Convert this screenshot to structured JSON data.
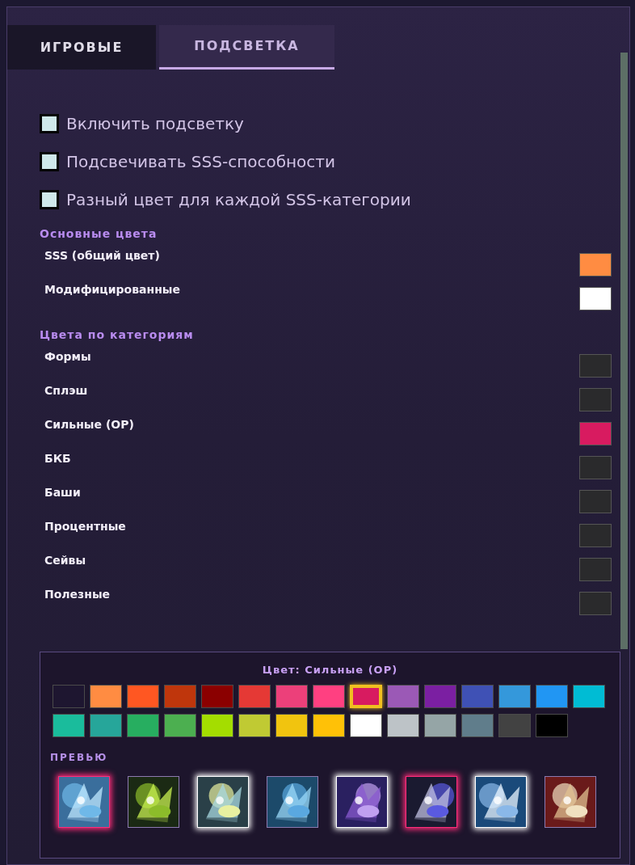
{
  "tabs": [
    {
      "label": "ИГРОВЫЕ",
      "selected": false
    },
    {
      "label": "ПОДСВЕТКА",
      "selected": true
    }
  ],
  "options": [
    {
      "label": "Включить подсветку",
      "checked": false
    },
    {
      "label": "Подсвечивать SSS-способности",
      "checked": false
    },
    {
      "label": "Разный цвет для каждой SSS-категории",
      "checked": false
    }
  ],
  "sections": [
    {
      "title": "Основные цвета",
      "rows": [
        {
          "label": "SSS (общий цвет)",
          "color": "#ff8c42"
        },
        {
          "label": "Модифицированные",
          "color": "#ffffff"
        }
      ]
    },
    {
      "title": "Цвета по категориям",
      "rows": [
        {
          "label": "Формы",
          "color": "#2a2a2c"
        },
        {
          "label": "Сплэш",
          "color": "#2a2a2c"
        },
        {
          "label": "Сильные (OP)",
          "color": "#d81b60"
        },
        {
          "label": "БКБ",
          "color": "#2a2a2c"
        },
        {
          "label": "Баши",
          "color": "#2a2a2c"
        },
        {
          "label": "Процентные",
          "color": "#2a2a2c"
        },
        {
          "label": "Сейвы",
          "color": "#2a2a2c"
        },
        {
          "label": "Полезные",
          "color": "#2a2a2c"
        }
      ]
    }
  ],
  "picker": {
    "title": "Цвет: Сильные (OP)",
    "swatches": [
      {
        "color": "#1e1630",
        "selected": false
      },
      {
        "color": "#ff8c42",
        "selected": false
      },
      {
        "color": "#ff5722",
        "selected": false
      },
      {
        "color": "#bf360c",
        "selected": false
      },
      {
        "color": "#8b0000",
        "selected": false
      },
      {
        "color": "#e53935",
        "selected": false
      },
      {
        "color": "#ec407a",
        "selected": false
      },
      {
        "color": "#ff4081",
        "selected": false
      },
      {
        "color": "#d81b60",
        "selected": true
      },
      {
        "color": "#9b59b6",
        "selected": false
      },
      {
        "color": "#7b1fa2",
        "selected": false
      },
      {
        "color": "#3f51b5",
        "selected": false
      },
      {
        "color": "#3498db",
        "selected": false
      },
      {
        "color": "#2196f3",
        "selected": false
      },
      {
        "color": "#00bcd4",
        "selected": false
      },
      {
        "color": "#1abc9c",
        "selected": false
      },
      {
        "color": "#26a69a",
        "selected": false
      },
      {
        "color": "#27ae60",
        "selected": false
      },
      {
        "color": "#4caf50",
        "selected": false
      },
      {
        "color": "#a4dd00",
        "selected": false
      },
      {
        "color": "#c0ca33",
        "selected": false
      },
      {
        "color": "#f1c40f",
        "selected": false
      },
      {
        "color": "#ffc107",
        "selected": false
      },
      {
        "color": "#ffffff",
        "selected": false
      },
      {
        "color": "#bdc3c7",
        "selected": false
      },
      {
        "color": "#95a5a6",
        "selected": false
      },
      {
        "color": "#607d8b",
        "selected": false
      },
      {
        "color": "#424242",
        "selected": false
      },
      {
        "color": "#000000",
        "selected": false
      }
    ],
    "preview_title": "ПРЕВЬЮ"
  }
}
